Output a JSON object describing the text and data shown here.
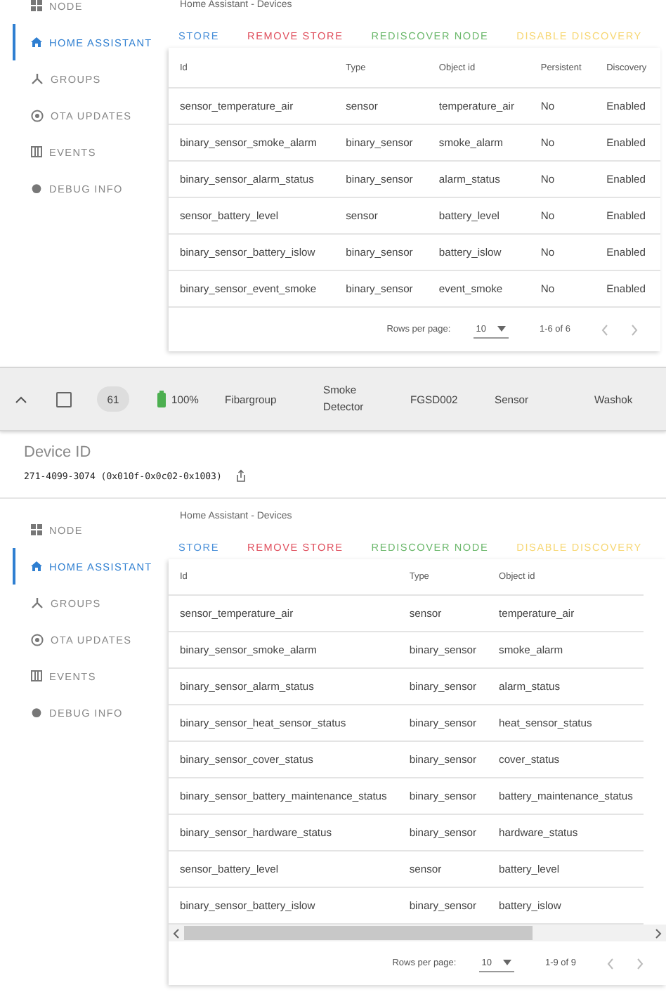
{
  "panels": [
    {
      "nav": [
        {
          "label": "NODE",
          "selected": false
        },
        {
          "label": "HOME ASSISTANT",
          "selected": true
        },
        {
          "label": "GROUPS",
          "selected": false
        },
        {
          "label": "OTA UPDATES",
          "selected": false
        },
        {
          "label": "EVENTS",
          "selected": false
        },
        {
          "label": "DEBUG INFO",
          "selected": false
        }
      ],
      "breadcrumb": "Home Assistant - Devices",
      "actions": [
        {
          "label": "STORE",
          "color": "#4a90d9"
        },
        {
          "label": "REMOVE STORE",
          "color": "#e0505e"
        },
        {
          "label": "REDISCOVER NODE",
          "color": "#6cb86c"
        },
        {
          "label": "DISABLE DISCOVERY",
          "color": "#f7d774"
        }
      ],
      "table": {
        "columns": [
          "Id",
          "Type",
          "Object id",
          "Persistent",
          "Discovery"
        ],
        "rows": [
          [
            "sensor_temperature_air",
            "sensor",
            "temperature_air",
            "No",
            "Enabled"
          ],
          [
            "binary_sensor_smoke_alarm",
            "binary_sensor",
            "smoke_alarm",
            "No",
            "Enabled"
          ],
          [
            "binary_sensor_alarm_status",
            "binary_sensor",
            "alarm_status",
            "No",
            "Enabled"
          ],
          [
            "sensor_battery_level",
            "sensor",
            "battery_level",
            "No",
            "Enabled"
          ],
          [
            "binary_sensor_battery_islow",
            "binary_sensor",
            "battery_islow",
            "No",
            "Enabled"
          ],
          [
            "binary_sensor_event_smoke",
            "binary_sensor",
            "event_smoke",
            "No",
            "Enabled"
          ]
        ]
      },
      "footer": {
        "rows_label": "Rows per page:",
        "rows_per_page": "10",
        "range": "1-6 of 6"
      }
    },
    {
      "nav": [
        {
          "label": "NODE",
          "selected": false
        },
        {
          "label": "HOME ASSISTANT",
          "selected": true
        },
        {
          "label": "GROUPS",
          "selected": false
        },
        {
          "label": "OTA UPDATES",
          "selected": false
        },
        {
          "label": "EVENTS",
          "selected": false
        },
        {
          "label": "DEBUG INFO",
          "selected": false
        }
      ],
      "breadcrumb": "Home Assistant - Devices",
      "actions": [
        {
          "label": "STORE",
          "color": "#4a90d9"
        },
        {
          "label": "REMOVE STORE",
          "color": "#e0505e"
        },
        {
          "label": "REDISCOVER NODE",
          "color": "#6cb86c"
        },
        {
          "label": "DISABLE DISCOVERY",
          "color": "#f7d774"
        }
      ],
      "table": {
        "columns": [
          "Id",
          "Type",
          "Object id"
        ],
        "rows": [
          [
            "sensor_temperature_air",
            "sensor",
            "temperature_air"
          ],
          [
            "binary_sensor_smoke_alarm",
            "binary_sensor",
            "smoke_alarm"
          ],
          [
            "binary_sensor_alarm_status",
            "binary_sensor",
            "alarm_status"
          ],
          [
            "binary_sensor_heat_sensor_status",
            "binary_sensor",
            "heat_sensor_status"
          ],
          [
            "binary_sensor_cover_status",
            "binary_sensor",
            "cover_status"
          ],
          [
            "binary_sensor_battery_maintenance_status",
            "binary_sensor",
            "battery_maintenance_status"
          ],
          [
            "binary_sensor_hardware_status",
            "binary_sensor",
            "hardware_status"
          ],
          [
            "sensor_battery_level",
            "sensor",
            "battery_level"
          ],
          [
            "binary_sensor_battery_islow",
            "binary_sensor",
            "battery_islow"
          ]
        ],
        "scrollbar": true
      },
      "footer": {
        "rows_label": "Rows per page:",
        "rows_per_page": "10",
        "range": "1-9 of 9"
      }
    }
  ],
  "device_row": {
    "expanded": true,
    "checked": false,
    "node_id": "61",
    "battery": "100%",
    "manufacturer": "Fibargroup",
    "product": "Smoke Detector",
    "model": "FGSD002",
    "type": "Sensor",
    "location": "Washok"
  },
  "device_id": {
    "title": "Device ID",
    "value": "271-4099-3074 (0x010f-0x0c02-0x1003)"
  }
}
